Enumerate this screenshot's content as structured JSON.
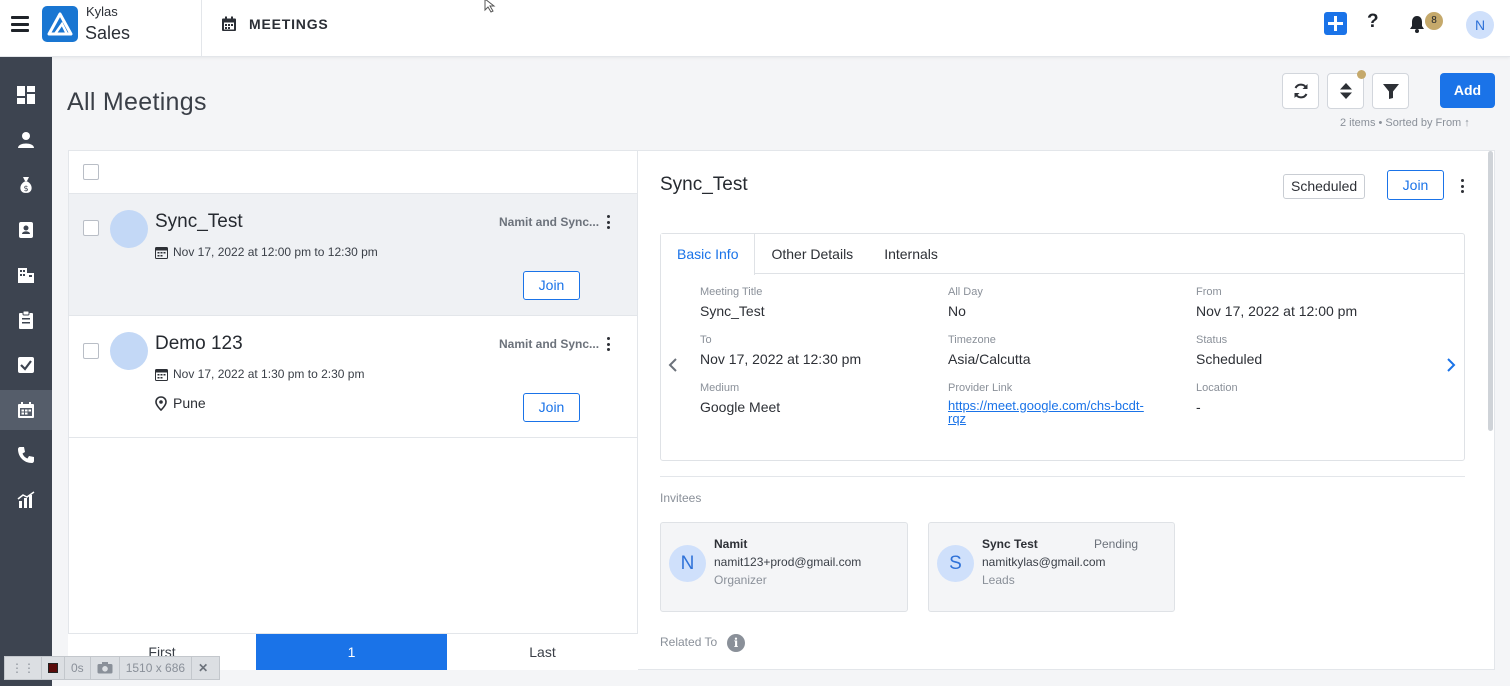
{
  "app": {
    "brand_top": "Kylas",
    "brand_bottom": "Sales",
    "module_title": "MEETINGS",
    "notification_count": "8",
    "user_initial": "N"
  },
  "page": {
    "title": "All Meetings",
    "meta": "2 items • Sorted by From ↑",
    "add_label": "Add"
  },
  "list": {
    "items": [
      {
        "title": "Sync_Test",
        "owner": "Namit and Sync...",
        "date": "Nov 17, 2022 at 12:00 pm to 12:30 pm",
        "location": "",
        "join_label": "Join"
      },
      {
        "title": "Demo 123",
        "owner": "Namit and Sync...",
        "date": "Nov 17, 2022 at 1:30 pm to 2:30 pm",
        "location": "Pune",
        "join_label": "Join"
      }
    ],
    "pager": {
      "first": "First",
      "current": "1",
      "last": "Last"
    }
  },
  "detail": {
    "title": "Sync_Test",
    "status": "Scheduled",
    "join_label": "Join",
    "tabs": [
      "Basic Info",
      "Other Details",
      "Internals"
    ],
    "fields": {
      "meeting_title": {
        "label": "Meeting Title",
        "value": "Sync_Test"
      },
      "all_day": {
        "label": "All Day",
        "value": "No"
      },
      "from": {
        "label": "From",
        "value": "Nov 17, 2022 at 12:00 pm"
      },
      "to": {
        "label": "To",
        "value": "Nov 17, 2022 at 12:30 pm"
      },
      "timezone": {
        "label": "Timezone",
        "value": "Asia/Calcutta"
      },
      "status": {
        "label": "Status",
        "value": "Scheduled"
      },
      "medium": {
        "label": "Medium",
        "value": "Google Meet"
      },
      "provider_link": {
        "label": "Provider Link",
        "value": "https://meet.google.com/chs-bcdt-rqz"
      },
      "location": {
        "label": "Location",
        "value": "-"
      }
    },
    "invitees_label": "Invitees",
    "invitees": [
      {
        "initial": "N",
        "name": "Namit",
        "email": "namit123+prod@gmail.com",
        "role": "Organizer",
        "status": ""
      },
      {
        "initial": "S",
        "name": "Sync Test",
        "email": "namitkylas@gmail.com",
        "role": "Leads",
        "status": "Pending"
      }
    ],
    "related_label": "Related To"
  },
  "recorder": {
    "time": "0s",
    "size": "1510 x 686"
  },
  "colors": {
    "primary": "#1a73e8",
    "sidebar": "#3d4450",
    "badge": "#c5a96b"
  }
}
